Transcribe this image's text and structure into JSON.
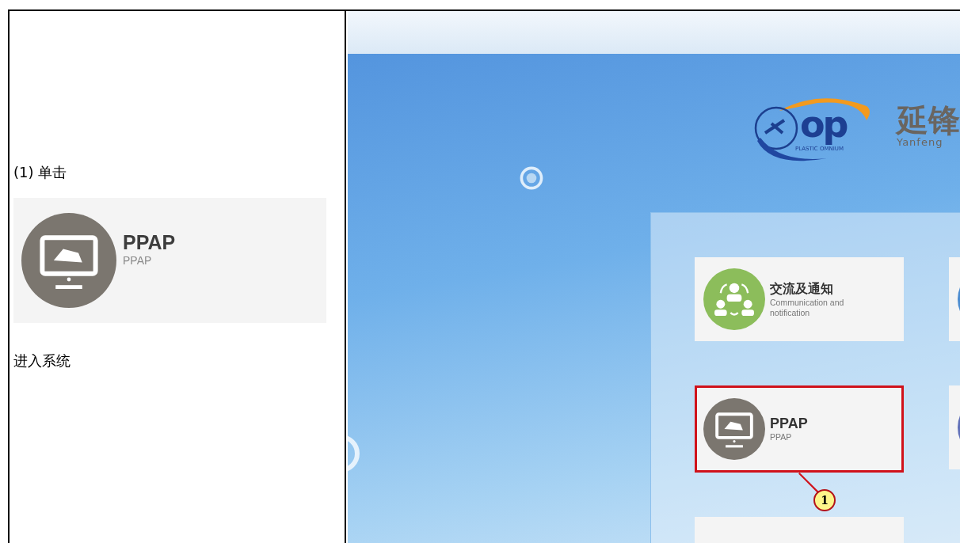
{
  "instruction": {
    "step_label": "(1) 单击",
    "preview_card": {
      "title": "PPAP",
      "subtitle": "PPAP"
    },
    "result": "进入系统"
  },
  "screenshot": {
    "logo": {
      "mark": "op",
      "caption": "PLASTIC OMNIUM",
      "name_cn": "延锋",
      "name_en": "Yanfeng"
    },
    "cards": [
      {
        "kind": "communication",
        "title": "交流及通知",
        "subtitle": "Communication and notification",
        "highlighted": false
      },
      {
        "kind": "ppap",
        "title": "PPAP",
        "subtitle": "PPAP",
        "highlighted": true
      }
    ],
    "callout": "1"
  }
}
